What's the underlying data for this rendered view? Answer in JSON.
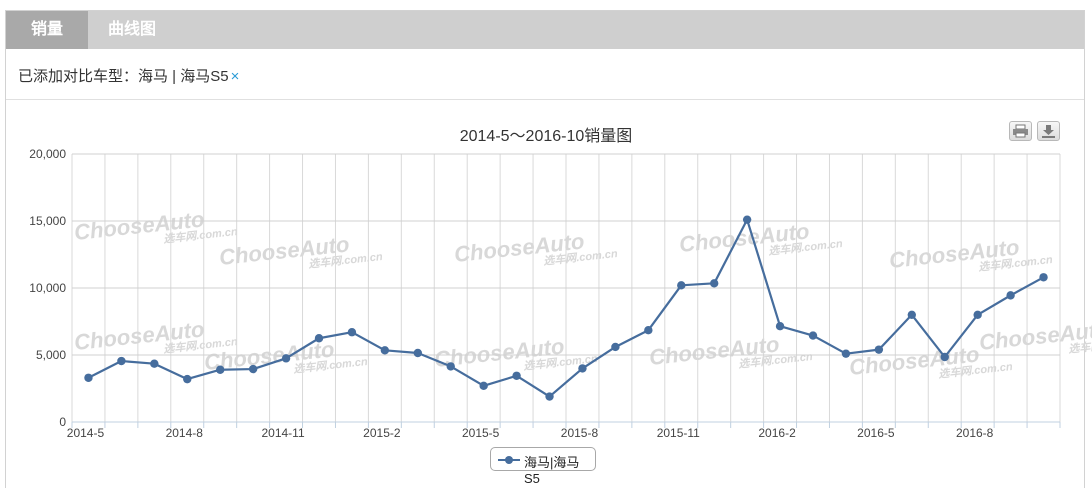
{
  "tabs": [
    {
      "label": "销量"
    },
    {
      "label": "曲线图"
    }
  ],
  "compare": {
    "prefix": "已添加对比车型：",
    "model": "海马 | 海马S5",
    "remove_glyph": "×"
  },
  "toolbar": {
    "print_icon": "print-icon",
    "download_icon": "download-icon"
  },
  "watermark": {
    "brand": "ChooseAuto",
    "sub": "选车网.com.cn"
  },
  "colors": {
    "series": "#466d9d",
    "remove": "#2a9bd6"
  },
  "chart_data": {
    "type": "line",
    "title": "2014-5～2016-10销量图",
    "xlabel": "",
    "ylabel": "",
    "ylim": [
      0,
      20000
    ],
    "yticks": [
      "0",
      "5,000",
      "10,000",
      "15,000",
      "20,000"
    ],
    "x": [
      "2014-5",
      "2014-6",
      "2014-7",
      "2014-8",
      "2014-9",
      "2014-10",
      "2014-11",
      "2014-12",
      "2015-1",
      "2015-2",
      "2015-3",
      "2015-4",
      "2015-5",
      "2015-6",
      "2015-7",
      "2015-8",
      "2015-9",
      "2015-10",
      "2015-11",
      "2015-12",
      "2016-1",
      "2016-2",
      "2016-3",
      "2016-4",
      "2016-5",
      "2016-6",
      "2016-7",
      "2016-8",
      "2016-9",
      "2016-10"
    ],
    "xtick_labels": [
      "2014-5",
      "2014-8",
      "2014-11",
      "2015-2",
      "2015-5",
      "2015-8",
      "2015-11",
      "2016-2",
      "2016-5",
      "2016-8"
    ],
    "series": [
      {
        "name": "海马|海马S5",
        "values": [
          3300,
          4550,
          4350,
          3200,
          3900,
          3950,
          4750,
          6250,
          6700,
          5350,
          5150,
          4150,
          2700,
          3450,
          1900,
          4000,
          5600,
          6850,
          10200,
          10350,
          15100,
          7150,
          6450,
          5100,
          5400,
          8000,
          4850,
          8000,
          9450,
          10800
        ]
      }
    ],
    "grid": true,
    "legend": "bottom-center"
  }
}
